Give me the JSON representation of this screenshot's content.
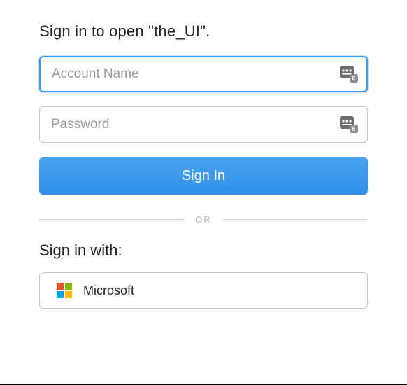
{
  "title": "Sign in to open \"the_UI\".",
  "fields": {
    "account": {
      "placeholder": "Account Name",
      "value": ""
    },
    "password": {
      "placeholder": "Password",
      "value": ""
    }
  },
  "buttons": {
    "signin": "Sign In"
  },
  "divider": "OR",
  "sso": {
    "heading": "Sign in with:",
    "provider_label": "Microsoft"
  },
  "icons": {
    "keychain": "keychain-autofill-icon",
    "microsoft": "microsoft-logo"
  }
}
